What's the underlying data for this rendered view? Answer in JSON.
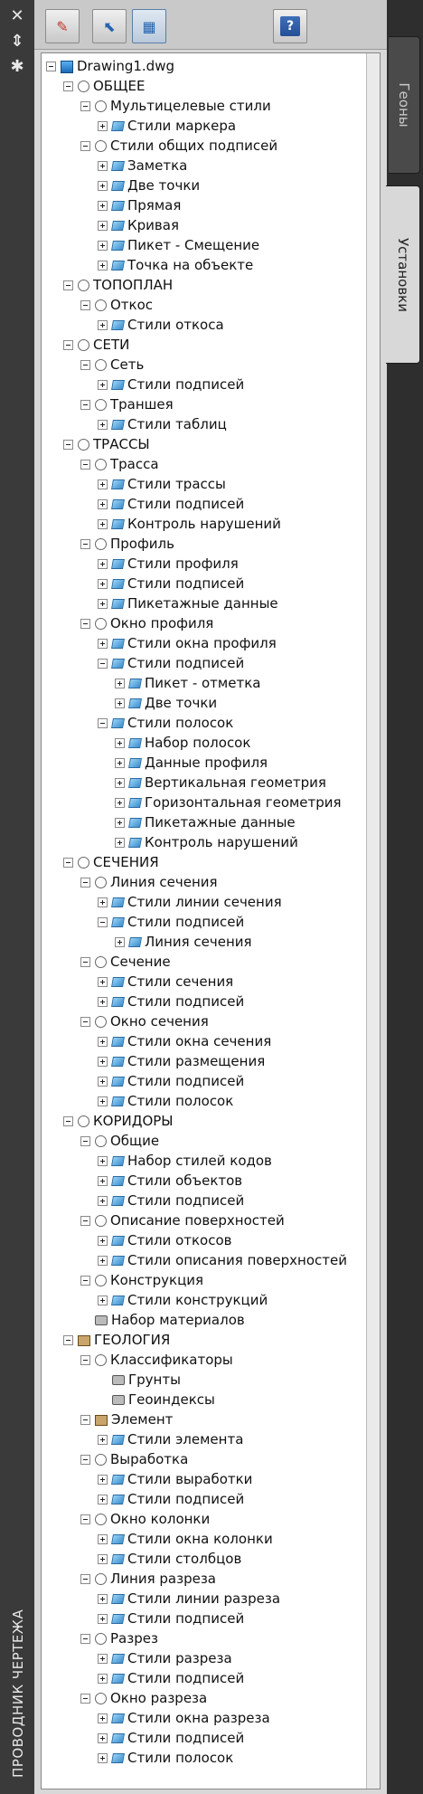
{
  "palette": {
    "title": "ПРОВОДНИК ЧЕРТЕЖА",
    "left_icons": [
      "close-icon",
      "collapse-icon",
      "settings-icon"
    ],
    "tabs": [
      {
        "label": "Геоны",
        "active": false
      },
      {
        "label": "Установки",
        "active": true
      }
    ],
    "toolbar": [
      "edit-icon",
      "expand-icon",
      "view-icon",
      "help-icon"
    ],
    "help_glyph": "?"
  },
  "tree": [
    {
      "depth": 0,
      "text": "Drawing1.dwg",
      "exp": "minus",
      "icon": "drawing"
    },
    {
      "depth": 1,
      "text": "ОБЩЕЕ",
      "exp": "minus",
      "icon": "group"
    },
    {
      "depth": 2,
      "text": "Мультицелевые стили",
      "exp": "minus",
      "icon": "group"
    },
    {
      "depth": 3,
      "text": "Стили маркера",
      "exp": "plus",
      "icon": "style"
    },
    {
      "depth": 2,
      "text": "Стили общих подписей",
      "exp": "minus",
      "icon": "group"
    },
    {
      "depth": 3,
      "text": "Заметка",
      "exp": "plus",
      "icon": "style"
    },
    {
      "depth": 3,
      "text": "Две точки",
      "exp": "plus",
      "icon": "style"
    },
    {
      "depth": 3,
      "text": "Прямая",
      "exp": "plus",
      "icon": "style"
    },
    {
      "depth": 3,
      "text": "Кривая",
      "exp": "plus",
      "icon": "style"
    },
    {
      "depth": 3,
      "text": "Пикет - Смещение",
      "exp": "plus",
      "icon": "style"
    },
    {
      "depth": 3,
      "text": "Точка на объекте",
      "exp": "plus",
      "icon": "style"
    },
    {
      "depth": 1,
      "text": "ТОПОПЛАН",
      "exp": "minus",
      "icon": "group"
    },
    {
      "depth": 2,
      "text": "Откос",
      "exp": "minus",
      "icon": "group"
    },
    {
      "depth": 3,
      "text": "Стили откоса",
      "exp": "plus",
      "icon": "style"
    },
    {
      "depth": 1,
      "text": "СЕТИ",
      "exp": "minus",
      "icon": "group"
    },
    {
      "depth": 2,
      "text": "Сеть",
      "exp": "minus",
      "icon": "group"
    },
    {
      "depth": 3,
      "text": "Стили подписей",
      "exp": "plus",
      "icon": "style"
    },
    {
      "depth": 2,
      "text": "Траншея",
      "exp": "minus",
      "icon": "group"
    },
    {
      "depth": 3,
      "text": "Стили таблиц",
      "exp": "plus",
      "icon": "style"
    },
    {
      "depth": 1,
      "text": "ТРАССЫ",
      "exp": "minus",
      "icon": "group"
    },
    {
      "depth": 2,
      "text": "Трасса",
      "exp": "minus",
      "icon": "group"
    },
    {
      "depth": 3,
      "text": "Стили трассы",
      "exp": "plus",
      "icon": "style"
    },
    {
      "depth": 3,
      "text": "Стили подписей",
      "exp": "plus",
      "icon": "style"
    },
    {
      "depth": 3,
      "text": "Контроль нарушений",
      "exp": "plus",
      "icon": "style"
    },
    {
      "depth": 2,
      "text": "Профиль",
      "exp": "minus",
      "icon": "group"
    },
    {
      "depth": 3,
      "text": "Стили профиля",
      "exp": "plus",
      "icon": "style"
    },
    {
      "depth": 3,
      "text": "Стили подписей",
      "exp": "plus",
      "icon": "style"
    },
    {
      "depth": 3,
      "text": "Пикетажные данные",
      "exp": "plus",
      "icon": "style"
    },
    {
      "depth": 2,
      "text": "Окно профиля",
      "exp": "minus",
      "icon": "group"
    },
    {
      "depth": 3,
      "text": "Стили окна профиля",
      "exp": "plus",
      "icon": "style"
    },
    {
      "depth": 3,
      "text": "Стили подписей",
      "exp": "minus",
      "icon": "style"
    },
    {
      "depth": 4,
      "text": "Пикет - отметка",
      "exp": "plus",
      "icon": "style"
    },
    {
      "depth": 4,
      "text": "Две точки",
      "exp": "plus",
      "icon": "style"
    },
    {
      "depth": 3,
      "text": "Стили полосок",
      "exp": "minus",
      "icon": "style"
    },
    {
      "depth": 4,
      "text": "Набор полосок",
      "exp": "plus",
      "icon": "style"
    },
    {
      "depth": 4,
      "text": "Данные профиля",
      "exp": "plus",
      "icon": "style"
    },
    {
      "depth": 4,
      "text": "Вертикальная геометрия",
      "exp": "plus",
      "icon": "style"
    },
    {
      "depth": 4,
      "text": "Горизонтальная геометрия",
      "exp": "plus",
      "icon": "style"
    },
    {
      "depth": 4,
      "text": "Пикетажные данные",
      "exp": "plus",
      "icon": "style"
    },
    {
      "depth": 4,
      "text": "Контроль нарушений",
      "exp": "plus",
      "icon": "style"
    },
    {
      "depth": 1,
      "text": "СЕЧЕНИЯ",
      "exp": "minus",
      "icon": "group"
    },
    {
      "depth": 2,
      "text": "Линия сечения",
      "exp": "minus",
      "icon": "group"
    },
    {
      "depth": 3,
      "text": "Стили линии сечения",
      "exp": "plus",
      "icon": "style"
    },
    {
      "depth": 3,
      "text": "Стили подписей",
      "exp": "minus",
      "icon": "style"
    },
    {
      "depth": 4,
      "text": "Линия сечения",
      "exp": "plus",
      "icon": "style"
    },
    {
      "depth": 2,
      "text": "Сечение",
      "exp": "minus",
      "icon": "group"
    },
    {
      "depth": 3,
      "text": "Стили сечения",
      "exp": "plus",
      "icon": "style"
    },
    {
      "depth": 3,
      "text": "Стили подписей",
      "exp": "plus",
      "icon": "style"
    },
    {
      "depth": 2,
      "text": "Окно сечения",
      "exp": "minus",
      "icon": "group"
    },
    {
      "depth": 3,
      "text": "Стили окна сечения",
      "exp": "plus",
      "icon": "style"
    },
    {
      "depth": 3,
      "text": "Стили размещения",
      "exp": "plus",
      "icon": "style"
    },
    {
      "depth": 3,
      "text": "Стили подписей",
      "exp": "plus",
      "icon": "style"
    },
    {
      "depth": 3,
      "text": "Стили полосок",
      "exp": "plus",
      "icon": "style"
    },
    {
      "depth": 1,
      "text": "КОРИДОРЫ",
      "exp": "minus",
      "icon": "group"
    },
    {
      "depth": 2,
      "text": "Общие",
      "exp": "minus",
      "icon": "group"
    },
    {
      "depth": 3,
      "text": "Набор стилей кодов",
      "exp": "plus",
      "icon": "style"
    },
    {
      "depth": 3,
      "text": "Стили объектов",
      "exp": "plus",
      "icon": "style"
    },
    {
      "depth": 3,
      "text": "Стили подписей",
      "exp": "plus",
      "icon": "style"
    },
    {
      "depth": 2,
      "text": "Описание поверхностей",
      "exp": "minus",
      "icon": "group"
    },
    {
      "depth": 3,
      "text": "Стили откосов",
      "exp": "plus",
      "icon": "style"
    },
    {
      "depth": 3,
      "text": "Стили описания поверхностей",
      "exp": "plus",
      "icon": "style"
    },
    {
      "depth": 2,
      "text": "Конструкция",
      "exp": "minus",
      "icon": "group"
    },
    {
      "depth": 3,
      "text": "Стили конструкций",
      "exp": "plus",
      "icon": "style"
    },
    {
      "depth": 2,
      "text": "Набор материалов",
      "exp": "none",
      "icon": "mat"
    },
    {
      "depth": 1,
      "text": "ГЕОЛОГИЯ",
      "exp": "minus",
      "icon": "geo"
    },
    {
      "depth": 2,
      "text": "Классификаторы",
      "exp": "minus",
      "icon": "group"
    },
    {
      "depth": 3,
      "text": "Грунты",
      "exp": "none",
      "icon": "mat"
    },
    {
      "depth": 3,
      "text": "Геоиндексы",
      "exp": "none",
      "icon": "mat"
    },
    {
      "depth": 2,
      "text": "Элемент",
      "exp": "minus",
      "icon": "geo"
    },
    {
      "depth": 3,
      "text": "Стили элемента",
      "exp": "plus",
      "icon": "style"
    },
    {
      "depth": 2,
      "text": "Выработка",
      "exp": "minus",
      "icon": "group"
    },
    {
      "depth": 3,
      "text": "Стили выработки",
      "exp": "plus",
      "icon": "style"
    },
    {
      "depth": 3,
      "text": "Стили подписей",
      "exp": "plus",
      "icon": "style"
    },
    {
      "depth": 2,
      "text": "Окно колонки",
      "exp": "minus",
      "icon": "group"
    },
    {
      "depth": 3,
      "text": "Стили окна колонки",
      "exp": "plus",
      "icon": "style"
    },
    {
      "depth": 3,
      "text": "Стили столбцов",
      "exp": "plus",
      "icon": "style"
    },
    {
      "depth": 2,
      "text": "Линия разреза",
      "exp": "minus",
      "icon": "group"
    },
    {
      "depth": 3,
      "text": "Стили линии разреза",
      "exp": "plus",
      "icon": "style"
    },
    {
      "depth": 3,
      "text": "Стили подписей",
      "exp": "plus",
      "icon": "style"
    },
    {
      "depth": 2,
      "text": "Разрез",
      "exp": "minus",
      "icon": "group"
    },
    {
      "depth": 3,
      "text": "Стили разреза",
      "exp": "plus",
      "icon": "style"
    },
    {
      "depth": 3,
      "text": "Стили подписей",
      "exp": "plus",
      "icon": "style"
    },
    {
      "depth": 2,
      "text": "Окно разреза",
      "exp": "minus",
      "icon": "group"
    },
    {
      "depth": 3,
      "text": "Стили окна разреза",
      "exp": "plus",
      "icon": "style"
    },
    {
      "depth": 3,
      "text": "Стили подписей",
      "exp": "plus",
      "icon": "style"
    },
    {
      "depth": 3,
      "text": "Стили полосок",
      "exp": "plus",
      "icon": "style"
    }
  ]
}
